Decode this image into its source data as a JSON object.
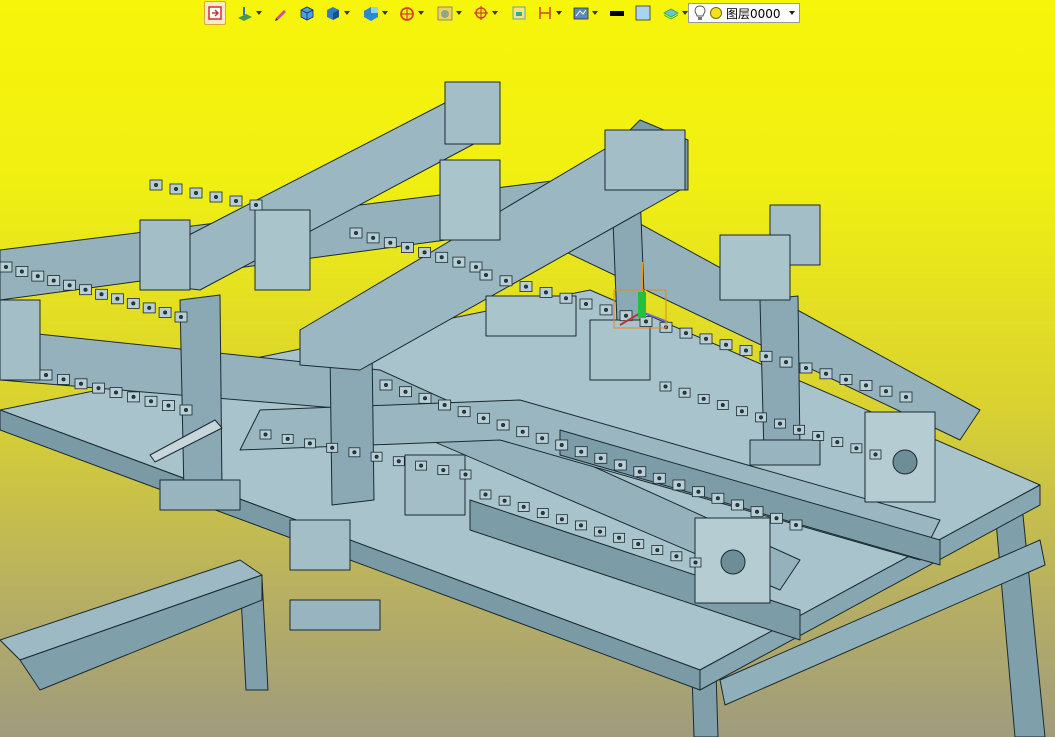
{
  "toolbar": {
    "items": [
      {
        "icon": "exit-sketch-icon",
        "active": true,
        "dropdown": false
      },
      {
        "icon": "sketch-plane-icon",
        "dropdown": true
      },
      {
        "icon": "pencil-icon",
        "dropdown": false
      },
      {
        "icon": "box-view-icon",
        "dropdown": false
      },
      {
        "icon": "solid-shade-icon",
        "dropdown": true
      },
      {
        "icon": "view-orient-icon",
        "dropdown": true
      },
      {
        "icon": "section-view-icon",
        "dropdown": true
      },
      {
        "icon": "render-style-icon",
        "dropdown": true
      },
      {
        "icon": "snap-point-icon",
        "dropdown": true
      },
      {
        "icon": "grid-icon",
        "dropdown": false
      },
      {
        "icon": "dimension-icon",
        "dropdown": true
      },
      {
        "icon": "display-filter-icon",
        "dropdown": true
      },
      {
        "icon": "line-color-icon",
        "dropdown": false
      },
      {
        "icon": "face-color-icon",
        "dropdown": false
      },
      {
        "icon": "layer-icon",
        "dropdown": true
      }
    ],
    "layer": {
      "value": "图层0000"
    }
  },
  "colors": {
    "background_top": "#f7f509",
    "background_bottom": "#9f9b7d",
    "model_face": "#8aa9b4",
    "model_edge": "#1a2a30"
  }
}
